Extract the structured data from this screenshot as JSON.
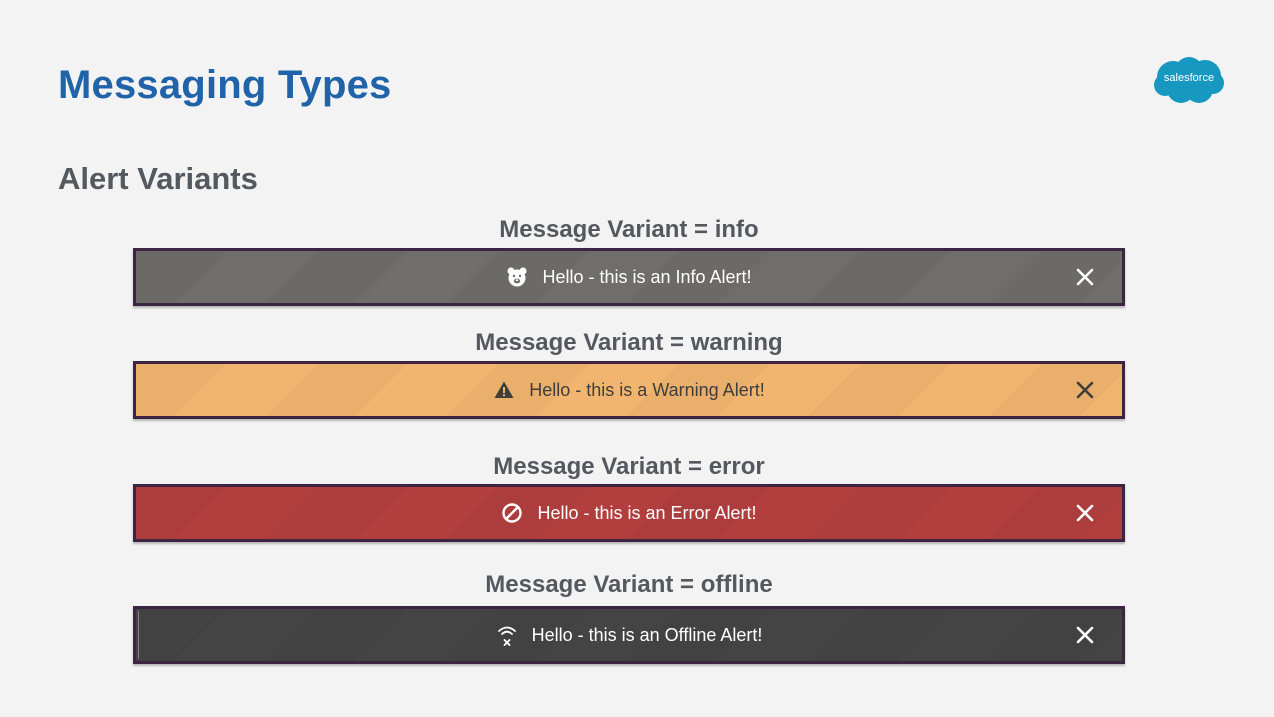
{
  "page": {
    "title": "Messaging Types",
    "section_heading": "Alert Variants"
  },
  "brand": {
    "logo_text": "salesforce",
    "logo_color": "#1798c1",
    "title_color": "#2163a8"
  },
  "alerts": [
    {
      "variant_label": "Message Variant = info",
      "message": "Hello - this is an Info Alert!",
      "icon": "bear-icon",
      "background": "#706e6b"
    },
    {
      "variant_label": "Message Variant = warning",
      "message": "Hello - this is a Warning Alert!",
      "icon": "warning-icon",
      "background": "#f2b56f"
    },
    {
      "variant_label": "Message Variant = error",
      "message": "Hello - this is an Error Alert!",
      "icon": "ban-icon",
      "background": "#b33e3e"
    },
    {
      "variant_label": "Message Variant = offline",
      "message": "Hello - this is an Offline Alert!",
      "icon": "offline-wifi-icon",
      "background": "#444444"
    }
  ]
}
